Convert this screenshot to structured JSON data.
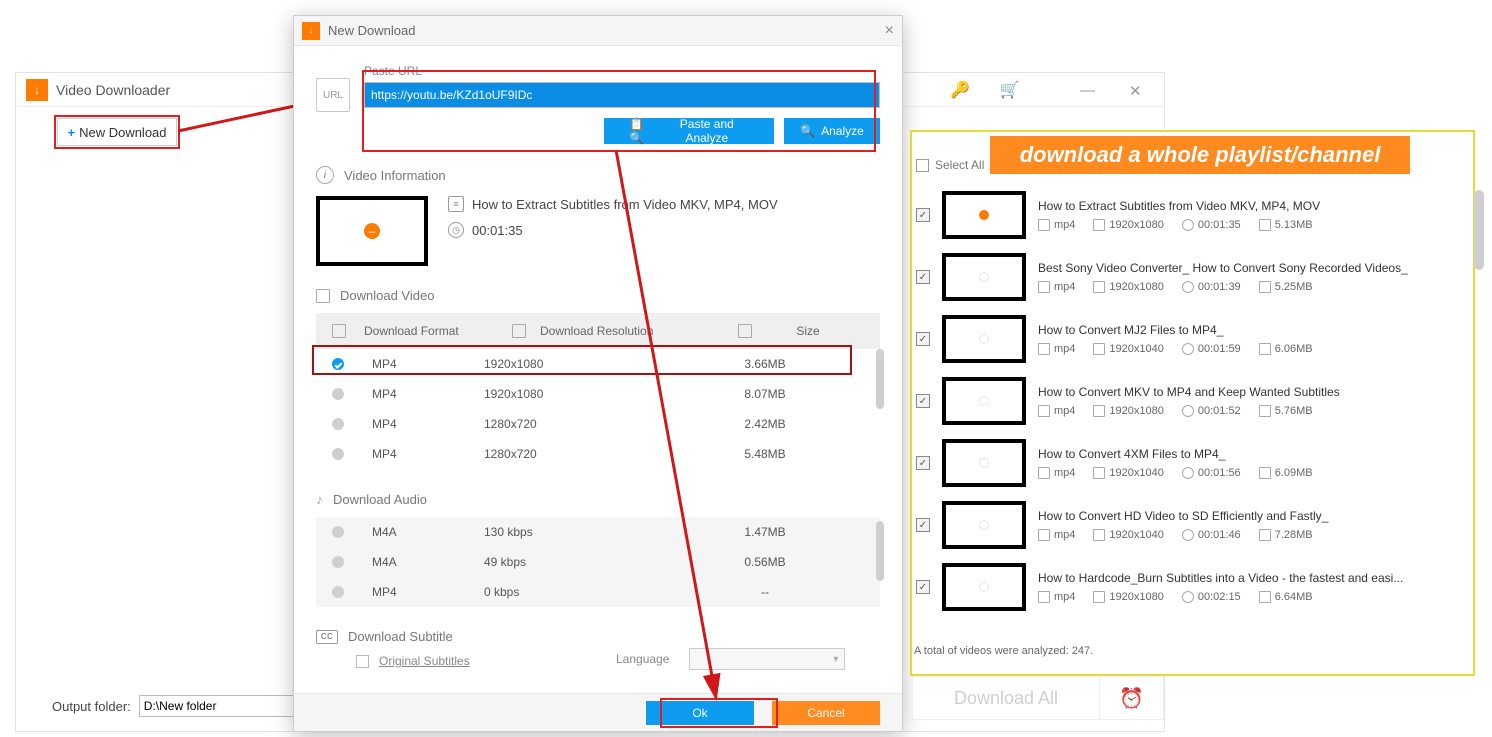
{
  "main": {
    "title": "Video Downloader",
    "new_download": "New Download",
    "output_label": "Output folder:",
    "output_value": "D:\\New folder"
  },
  "dialog": {
    "title": "New Download",
    "paste_url_label": "Paste URL",
    "url_value": "https://youtu.be/KZd1oUF9IDc",
    "paste_analyze": "Paste and Analyze",
    "analyze": "Analyze",
    "video_info_label": "Video Information",
    "video_title": "How to Extract Subtitles from Video MKV, MP4, MOV",
    "video_duration": "00:01:35",
    "download_video_label": "Download Video",
    "headers": {
      "format": "Download Format",
      "resolution": "Download Resolution",
      "size": "Size"
    },
    "video_rows": [
      {
        "fmt": "MP4",
        "res": "1920x1080",
        "size": "3.66MB",
        "selected": true
      },
      {
        "fmt": "MP4",
        "res": "1920x1080",
        "size": "8.07MB",
        "selected": false
      },
      {
        "fmt": "MP4",
        "res": "1280x720",
        "size": "2.42MB",
        "selected": false
      },
      {
        "fmt": "MP4",
        "res": "1280x720",
        "size": "5.48MB",
        "selected": false
      }
    ],
    "download_audio_label": "Download Audio",
    "audio_rows": [
      {
        "fmt": "M4A",
        "res": "130 kbps",
        "size": "1.47MB"
      },
      {
        "fmt": "M4A",
        "res": "49 kbps",
        "size": "0.56MB"
      },
      {
        "fmt": "MP4",
        "res": "0 kbps",
        "size": "--"
      }
    ],
    "download_subtitle_label": "Download Subtitle",
    "original_subtitles": "Original Subtitles",
    "language_label": "Language",
    "ok": "Ok",
    "cancel": "Cancel"
  },
  "playlist": {
    "callout": "download a whole playlist/channel",
    "select_all": "Select All",
    "items": [
      {
        "title": "How to Extract Subtitles from Video MKV, MP4, MOV",
        "fmt": "mp4",
        "res": "1920x1080",
        "dur": "00:01:35",
        "size": "5.13MB",
        "thumb": "orange"
      },
      {
        "title": "Best Sony Video Converter_ How to Convert Sony Recorded Videos_",
        "fmt": "mp4",
        "res": "1920x1080",
        "dur": "00:01:39",
        "size": "5.25MB",
        "thumb": "spin"
      },
      {
        "title": "How to Convert MJ2 Files to MP4_",
        "fmt": "mp4",
        "res": "1920x1040",
        "dur": "00:01:59",
        "size": "6.06MB",
        "thumb": "spin"
      },
      {
        "title": "How to Convert MKV to MP4 and Keep Wanted Subtitles",
        "fmt": "mp4",
        "res": "1920x1080",
        "dur": "00:01:52",
        "size": "5.76MB",
        "thumb": "spin"
      },
      {
        "title": "How to Convert 4XM Files to MP4_",
        "fmt": "mp4",
        "res": "1920x1040",
        "dur": "00:01:56",
        "size": "6.09MB",
        "thumb": "spin"
      },
      {
        "title": "How to Convert HD Video to SD Efficiently and Fastly_",
        "fmt": "mp4",
        "res": "1920x1040",
        "dur": "00:01:46",
        "size": "7.28MB",
        "thumb": "spin"
      },
      {
        "title": "How to Hardcode_Burn Subtitles into a Video - the fastest and easi...",
        "fmt": "mp4",
        "res": "1920x1080",
        "dur": "00:02:15",
        "size": "6.64MB",
        "thumb": "spin"
      }
    ],
    "summary": "A total of videos were analyzed: 247.",
    "download_all": "Download All"
  }
}
